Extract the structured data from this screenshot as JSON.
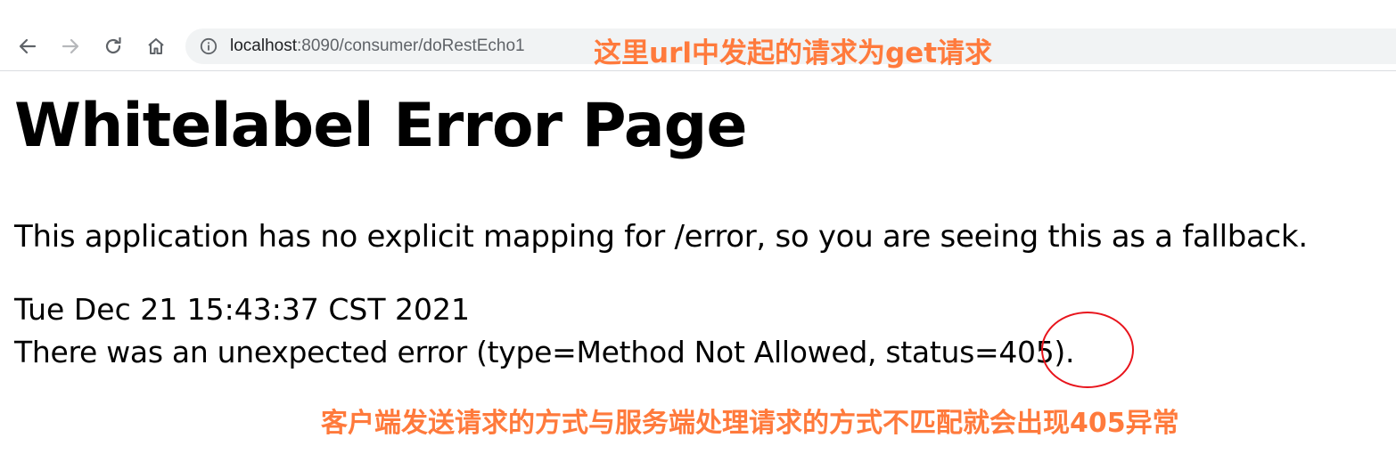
{
  "browser": {
    "url_host": "localhost",
    "url_port": ":8090",
    "url_path": "/consumer/doRestEcho1",
    "icons": {
      "back": "back-arrow-icon",
      "forward": "forward-arrow-icon",
      "reload": "reload-icon",
      "home": "home-icon",
      "info": "info-icon"
    }
  },
  "annotations": {
    "top": "这里url中发起的请求为get请求",
    "bottom": "客户端发送请求的方式与服务端处理请求的方式不匹配就会出现405异常",
    "color": "#ff7a3c",
    "circle_color": "#e8141c"
  },
  "page": {
    "title": "Whitelabel Error Page",
    "message": "This application has no explicit mapping for /error, so you are seeing this as a fallback.",
    "timestamp": "Tue Dec 21 15:43:37 CST 2021",
    "error_line": "There was an unexpected error (type=Method Not Allowed, status=405)."
  }
}
